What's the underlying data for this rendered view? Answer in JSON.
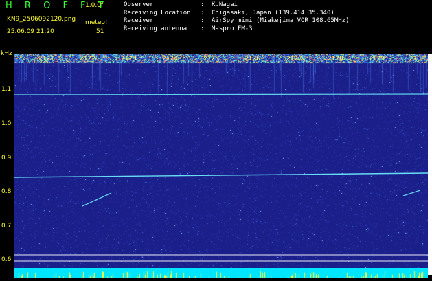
{
  "header": {
    "app_title": "H R O F F T",
    "version": "1.0.0f",
    "filename": "KN9_2506092120.png",
    "meteo_label": "meteo!",
    "datetime": "25.06.09 21:20",
    "count": "51",
    "info": [
      {
        "key": "Observer",
        "value": "K.Nagai"
      },
      {
        "key": "Receiving Location",
        "value": "Chigasaki, Japan (139.414 35.340)"
      },
      {
        "key": "Receiver",
        "value": "AirSpy mini (Miakejima VOR 108.65MHz)"
      },
      {
        "key": "Receiving antenna",
        "value": "Maspro FM-3"
      }
    ]
  },
  "axis": {
    "unit": "kHz",
    "y_ticks": [
      "1.1",
      "1.0",
      "0.9",
      "0.8",
      "0.7",
      "0.6"
    ],
    "x_ticks": [
      "2121",
      "2122",
      "2123",
      "2124",
      "2125",
      "2126",
      "2127",
      "2128",
      "2129",
      "2130"
    ]
  },
  "colors": {
    "background": "#1a1f8a",
    "label_yellow": "#ffff33",
    "title_green": "#33ff33",
    "trace_cyan": "#6ff2ff",
    "bottom_band": "#00e5ff"
  }
}
